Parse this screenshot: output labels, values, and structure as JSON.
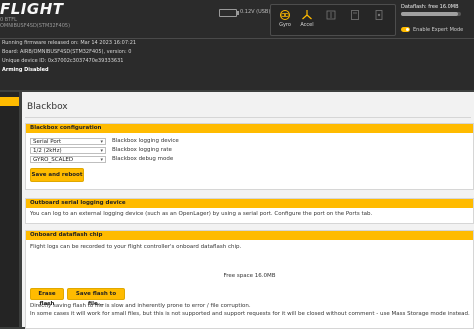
{
  "header": {
    "logo": "FLIGHT",
    "logo_sub1": "0 BTFL",
    "logo_sub2": "OMNIBUSF4SD(STM32F405)",
    "battery_voltage": "0.12V (USB)",
    "sensors": [
      {
        "label": "Gyro",
        "icon": "gyro-icon"
      },
      {
        "label": "Accel",
        "icon": "accel-icon"
      },
      {
        "label": "",
        "icon": "mag-icon"
      },
      {
        "label": "",
        "icon": "baro-icon"
      },
      {
        "label": "",
        "icon": "gps-icon"
      }
    ],
    "dataflash_label": "Dataflash: free 16.0MB",
    "dataflash_fill_fraction": 0.95,
    "expert_mode_label": "Enable Expert Mode"
  },
  "log": {
    "line1": "Running firmware released on: Mar 14 2023 16:07:21",
    "line2": "Board: AIRB/OMNIBUSF4SD(STM32F405), version: 0",
    "line3": "Unique device ID: 0x37002c3037470e39333631",
    "line4": "Arming Disabled"
  },
  "page": {
    "title": "Blackbox"
  },
  "config_panel": {
    "title": "Blackbox configuration",
    "rows": [
      {
        "value": "Serial Port",
        "label": "Blackbox logging device"
      },
      {
        "value": "1/2 (2kHz)",
        "label": "Blackbox logging rate"
      },
      {
        "value": "GYRO_SCALED",
        "label": "Blackbox debug mode"
      }
    ],
    "save_button": "Save and reboot"
  },
  "serial_panel": {
    "title": "Outboard serial logging device",
    "text": "You can log to an external logging device (such as an OpenLager) by using a serial port. Configure the port on the Ports tab."
  },
  "dataflash_panel": {
    "title": "Onboard dataflash chip",
    "text": "Flight logs can be recorded to your flight controller's onboard dataflash chip.",
    "free_space": "Free space 16.0MB",
    "erase_button": "Erase flash",
    "save_button": "Save flash to file...",
    "note1": "Directly saving flash to file is slow and inherently prone to error / file corruption.",
    "note2": "In some cases it will work for small files, but this is not supported and support requests for it will be closed without comment - use Mass Storage mode instead."
  },
  "colors": {
    "accent": "#ffbb00",
    "topbar": "#2b2b2b",
    "content_bg": "#f2f2f2"
  }
}
